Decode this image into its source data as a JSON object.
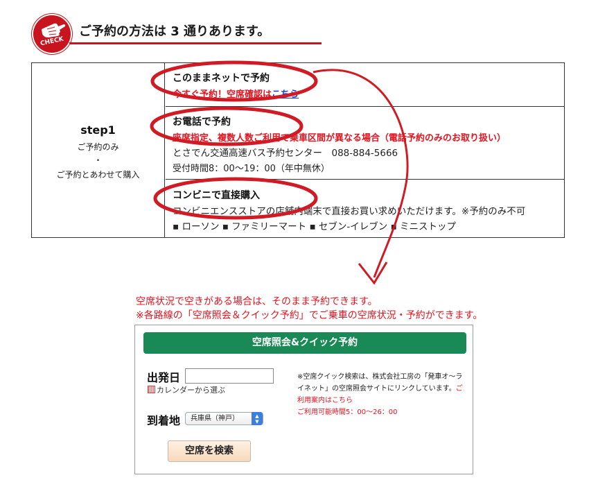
{
  "header": {
    "badge_text": "CHECK",
    "title": "ご予約の方法は 3 通りあります。"
  },
  "step": {
    "label": "step1",
    "line1": "ご予約のみ",
    "line2": "・",
    "line3": "ご予約とあわせて購入"
  },
  "methods": [
    {
      "title": "このままネットで予約",
      "link_prefix": "今すぐ予約！空席確認は",
      "link_text": "こちら"
    },
    {
      "title": "お電話で予約",
      "notice": "座席指定、複数人数ご利用で乗車区間が異なる場合（電話予約のみのお取り扱い）",
      "center": "とさでん交通高速バス予約センター　088-884-5666",
      "hours": "受付時間8：00〜19：00（年中無休）"
    },
    {
      "title": "コンビニで直接購入",
      "text": "コンビニエンスストアの店舗内端末で直接お買い求めいただけます。※予約のみ不可",
      "stores": "▪ ローソン ▪ ファミリーマート ▪ セブン-イレブン ▪ ミニストップ"
    }
  ],
  "notes": {
    "line1": "空席状況で空きがある場合は、そのまま予約できます。",
    "line2": "※各路線の「空席照会＆クイック予約」でご乗車の空席状況・予約ができます。"
  },
  "widget": {
    "header": "空席照会&クイック予約",
    "departure_label": "出発日",
    "departure_value": "",
    "calendar_link": "カレンダーから選ぶ",
    "destination_label": "到着地",
    "destination_value": "兵庫県（神戸）",
    "search_button": "空席を検索",
    "note_text": "※空席クイック検索は、株式会社工房の「発車オ〜ライネット」の空席照会サイトにリンクしています。",
    "guide_link": "ご利用案内はこちら",
    "available_hours": "ご利用可能時間5：00〜26：00"
  },
  "colors": {
    "accent_red": "#e4131e",
    "badge_red": "#c8141e",
    "widget_green": "#198a56",
    "link_blue": "#1a3cd6"
  }
}
